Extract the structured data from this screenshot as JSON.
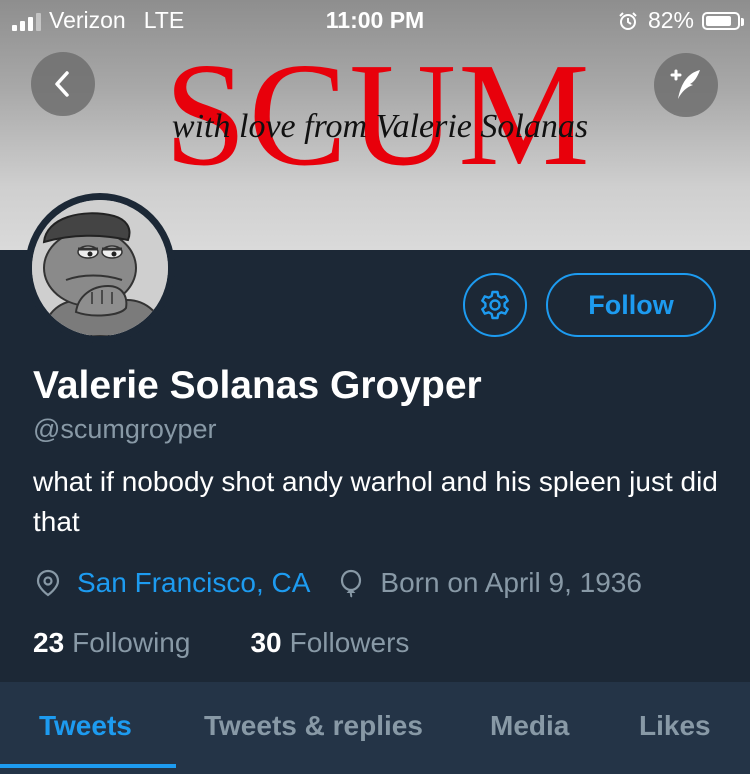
{
  "status_bar": {
    "carrier": "Verizon",
    "network": "LTE",
    "time": "11:00 PM",
    "battery": "82%",
    "battery_level": 0.82
  },
  "header": {
    "banner_title": "SCUM",
    "banner_subtitle": "with love from Valerie Solanas"
  },
  "profile": {
    "display_name": "Valerie Solanas Groyper",
    "handle": "@scumgroyper",
    "bio": "what if nobody shot andy warhol and his spleen just did that",
    "location": "San Francisco, CA",
    "born": "Born on April 9, 1936",
    "following_count": "23",
    "following_label": "Following",
    "followers_count": "30",
    "followers_label": "Followers"
  },
  "actions": {
    "follow_label": "Follow"
  },
  "tabs": [
    {
      "label": "Tweets",
      "active": true
    },
    {
      "label": "Tweets & replies",
      "active": false
    },
    {
      "label": "Media",
      "active": false
    },
    {
      "label": "Likes",
      "active": false
    }
  ],
  "colors": {
    "accent": "#1d9bf0",
    "background": "#1c2836",
    "tabbar": "#243447",
    "muted_text": "#8899a6",
    "banner_title": "#e8000b"
  },
  "icons": {
    "back": "chevron-left-icon",
    "compose": "compose-quill-icon",
    "settings": "gear-icon",
    "location": "location-pin-icon",
    "born": "balloon-icon",
    "alarm": "alarm-icon"
  }
}
